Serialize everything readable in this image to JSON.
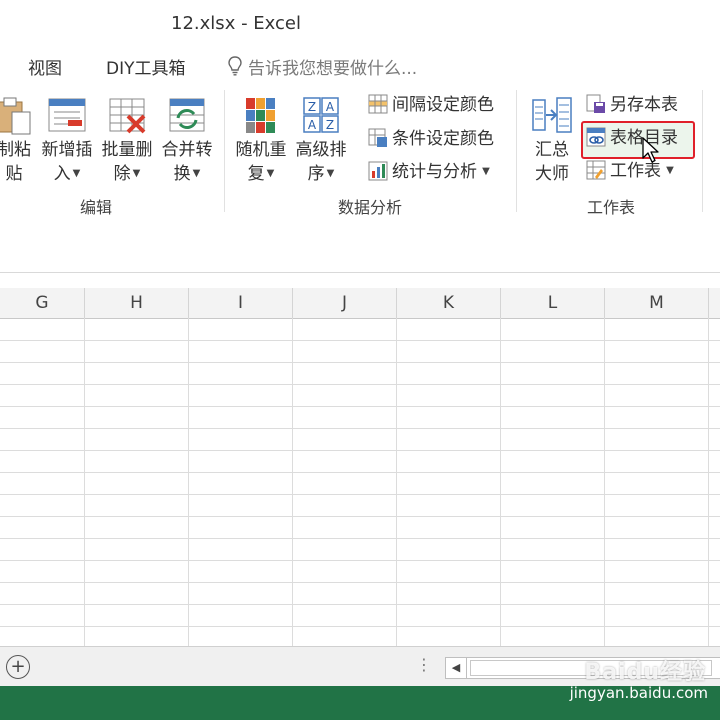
{
  "window": {
    "title": "12.xlsx - Excel"
  },
  "menu": {
    "items": [
      "视图",
      "DIY工具箱"
    ],
    "tell_me": "告诉我您想要做什么..."
  },
  "ribbon": {
    "groups": [
      {
        "label": "编辑"
      },
      {
        "label": "数据分析"
      },
      {
        "label": "工作表"
      }
    ],
    "buttons": {
      "copy_paste": {
        "line1": "制粘",
        "line2": "贴"
      },
      "add_insert": {
        "line1": "新增插",
        "line2": "入"
      },
      "batch_delete": {
        "line1": "批量删",
        "line2": "除"
      },
      "merge_convert": {
        "line1": "合并转",
        "line2": "换"
      },
      "random_repeat": {
        "line1": "随机重",
        "line2": "复"
      },
      "advanced_sort": {
        "line1": "高级排",
        "line2": "序"
      },
      "interval_color": "间隔设定颜色",
      "condition_color": "条件设定颜色",
      "stats_analysis": "统计与分析",
      "summary_master": {
        "line1": "汇总",
        "line2": "大师"
      },
      "save_this_sheet": "另存本表",
      "table_index": "表格目录",
      "worksheet": "工作表"
    }
  },
  "grid": {
    "columns": [
      "G",
      "H",
      "I",
      "J",
      "K",
      "L",
      "M"
    ]
  },
  "watermark": {
    "logo": "Baidu经验",
    "url": "jingyan.baidu.com"
  },
  "colors": {
    "status_bar": "#217346",
    "highlight": "#e0202a"
  }
}
